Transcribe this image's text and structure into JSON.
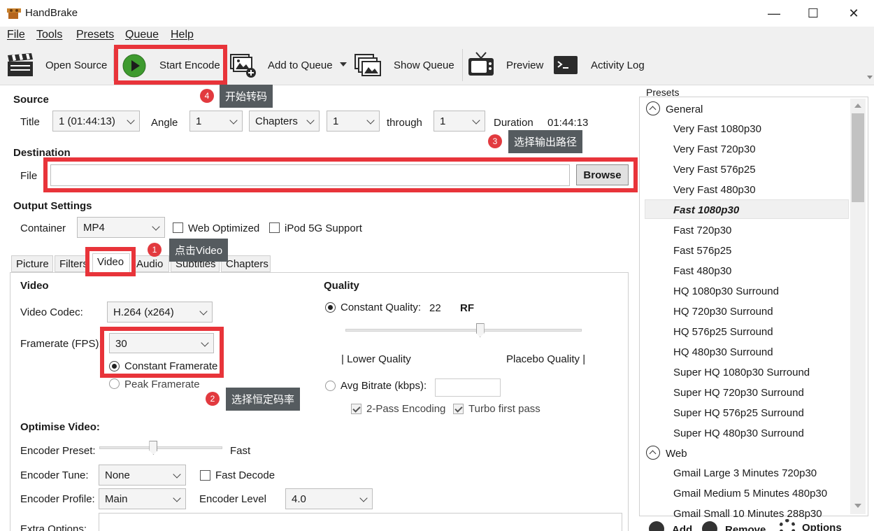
{
  "window": {
    "title": "HandBrake",
    "minimize": "—",
    "maximize": "☐",
    "close": "✕"
  },
  "menu": [
    "File",
    "Tools",
    "Presets",
    "Queue",
    "Help"
  ],
  "toolbar": {
    "open_source": "Open Source",
    "start_encode": "Start Encode",
    "add_to_queue": "Add to Queue",
    "show_queue": "Show Queue",
    "preview": "Preview",
    "activity_log": "Activity Log"
  },
  "source": {
    "heading": "Source",
    "title_label": "Title",
    "title_value": "1 (01:44:13)",
    "angle_label": "Angle",
    "angle_value": "1",
    "chapters_value": "Chapters",
    "from_value": "1",
    "through_label": "through",
    "to_value": "1",
    "duration_label": "Duration",
    "duration_value": "01:44:13"
  },
  "destination": {
    "heading": "Destination",
    "file_label": "File",
    "file_value": "",
    "browse": "Browse"
  },
  "output": {
    "heading": "Output Settings",
    "container_label": "Container",
    "container_value": "MP4",
    "web_optimized": "Web Optimized",
    "ipod": "iPod 5G Support"
  },
  "tabs": [
    "Picture",
    "Filters",
    "Video",
    "Audio",
    "Subtitles",
    "Chapters"
  ],
  "video": {
    "heading": "Video",
    "codec_label": "Video Codec:",
    "codec_value": "H.264 (x264)",
    "fps_label": "Framerate (FPS):",
    "fps_value": "30",
    "constant_framerate": "Constant Framerate",
    "peak_framerate": "Peak Framerate"
  },
  "quality": {
    "heading": "Quality",
    "constant_quality": "Constant Quality:",
    "cq_value": "22",
    "rf": "RF",
    "cq_slider_fraction": 0.57,
    "lower_quality": "| Lower Quality",
    "placebo_quality": "Placebo Quality |",
    "avg_bitrate": "Avg Bitrate (kbps):",
    "bitrate_value": "",
    "two_pass": "2-Pass Encoding",
    "turbo": "Turbo first pass"
  },
  "optimise": {
    "heading": "Optimise Video:",
    "preset_label": "Encoder Preset:",
    "preset_value": "Fast",
    "preset_slider_fraction": 0.44,
    "tune_label": "Encoder Tune:",
    "tune_value": "None",
    "fast_decode": "Fast Decode",
    "profile_label": "Encoder Profile:",
    "profile_value": "Main",
    "level_label": "Encoder Level",
    "level_value": "4.0",
    "extra_label": "Extra Options:"
  },
  "annotations": [
    {
      "num": "1",
      "text": "点击Video"
    },
    {
      "num": "2",
      "text": "选择恒定码率"
    },
    {
      "num": "3",
      "text": "选择输出路径"
    },
    {
      "num": "4",
      "text": "开始转码"
    }
  ],
  "presets": {
    "heading": "Presets",
    "group_general": "General",
    "general": [
      "Very Fast 1080p30",
      "Very Fast 720p30",
      "Very Fast 576p25",
      "Very Fast 480p30",
      "Fast 1080p30",
      "Fast 720p30",
      "Fast 576p25",
      "Fast 480p30",
      "HQ 1080p30 Surround",
      "HQ 720p30 Surround",
      "HQ 576p25 Surround",
      "HQ 480p30 Surround",
      "Super HQ 1080p30 Surround",
      "Super HQ 720p30 Surround",
      "Super HQ 576p25 Surround",
      "Super HQ 480p30 Surround"
    ],
    "group_web": "Web",
    "web": [
      "Gmail Large 3 Minutes 720p30",
      "Gmail Medium 5 Minutes 480p30",
      "Gmail Small 10 Minutes 288p30"
    ],
    "add": "Add",
    "remove": "Remove",
    "options": "Options"
  },
  "colors": {
    "annotation_red": "#e8343a",
    "tooltip_gray": "#555b5f",
    "selected_row": "#f0f0f0"
  }
}
